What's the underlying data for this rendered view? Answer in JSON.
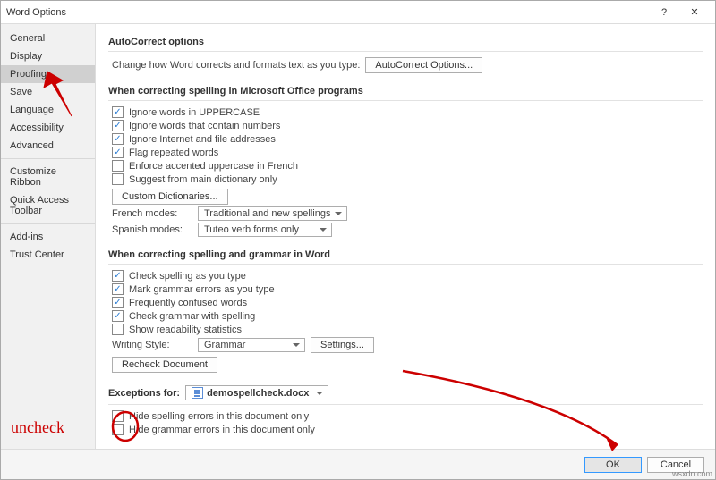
{
  "window": {
    "title": "Word Options"
  },
  "sidebar": {
    "items": [
      {
        "label": "General"
      },
      {
        "label": "Display"
      },
      {
        "label": "Proofing",
        "selected": true
      },
      {
        "label": "Save"
      },
      {
        "label": "Language"
      },
      {
        "label": "Accessibility"
      },
      {
        "label": "Advanced"
      }
    ],
    "items2": [
      {
        "label": "Customize Ribbon"
      },
      {
        "label": "Quick Access Toolbar"
      }
    ],
    "items3": [
      {
        "label": "Add-ins"
      },
      {
        "label": "Trust Center"
      }
    ]
  },
  "ac": {
    "group": "AutoCorrect options",
    "desc": "Change how Word corrects and formats text as you type:",
    "button": "AutoCorrect Options..."
  },
  "sp": {
    "group": "When correcting spelling in Microsoft Office programs",
    "c1": "Ignore words in UPPERCASE",
    "c2": "Ignore words that contain numbers",
    "c3": "Ignore Internet and file addresses",
    "c4": "Flag repeated words",
    "c5": "Enforce accented uppercase in French",
    "c6": "Suggest from main dictionary only",
    "dictBtn": "Custom Dictionaries...",
    "frLabel": "French modes:",
    "frVal": "Traditional and new spellings",
    "esLabel": "Spanish modes:",
    "esVal": "Tuteo verb forms only"
  },
  "gw": {
    "group": "When correcting spelling and grammar in Word",
    "c1": "Check spelling as you type",
    "c2": "Mark grammar errors as you type",
    "c3": "Frequently confused words",
    "c4": "Check grammar with spelling",
    "c5": "Show readability statistics",
    "wsLabel": "Writing Style:",
    "wsVal": "Grammar",
    "settingsBtn": "Settings...",
    "recheckBtn": "Recheck Document"
  },
  "ex": {
    "label": "Exceptions for:",
    "doc": "demospellcheck.docx",
    "c1": "Hide spelling errors in this document only",
    "c2": "Hide grammar errors in this document only"
  },
  "footer": {
    "ok": "OK",
    "cancel": "Cancel"
  },
  "ann": {
    "uncheck": "uncheck"
  },
  "watermark": "wsxdn.com"
}
